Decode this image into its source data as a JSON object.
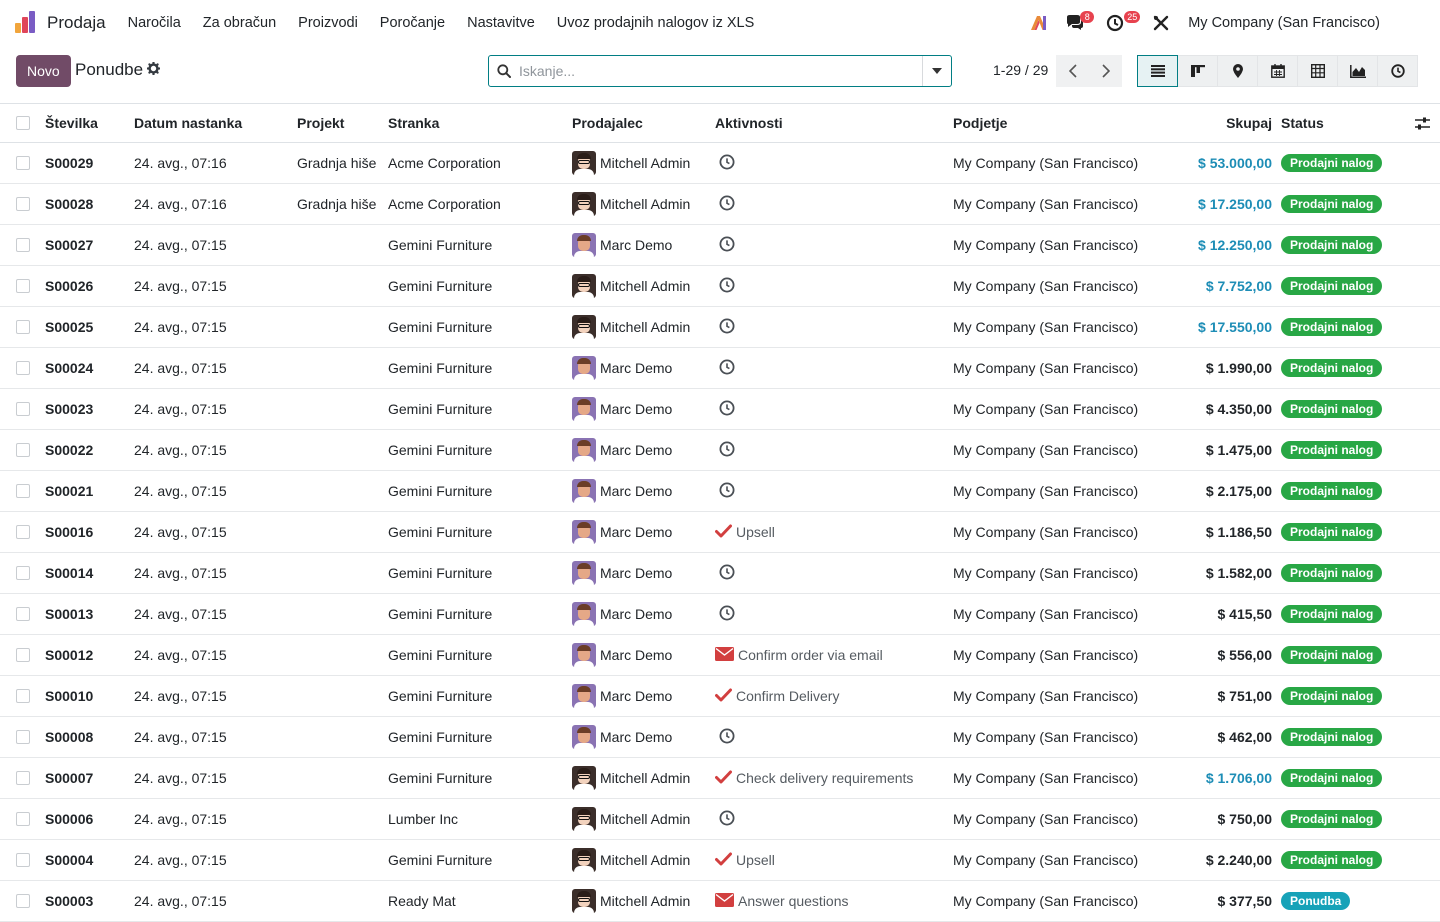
{
  "navbar": {
    "app_name": "Prodaja",
    "menu": [
      "Naročila",
      "Za obračun",
      "Proizvodi",
      "Poročanje",
      "Nastavitve",
      "Uvoz prodajnih nalogov iz XLS"
    ],
    "messages_count": "8",
    "activities_count": "25",
    "company": "My Company (San Francisco)"
  },
  "control": {
    "new_label": "Novo",
    "title": "Ponudbe",
    "search_placeholder": "Iskanje...",
    "pager": "1-29 / 29"
  },
  "colors": {
    "brand": "#714b67",
    "accent": "#017e84",
    "status_green": "#28a745",
    "status_blue": "#17a2b8",
    "amount_teal": "#1d8db6"
  },
  "columns": {
    "number": "Številka",
    "date": "Datum nastanka",
    "project": "Projekt",
    "customer": "Stranka",
    "salesperson": "Prodajalec",
    "activities": "Aktivnosti",
    "company": "Podjetje",
    "total": "Skupaj",
    "status": "Status"
  },
  "rows": [
    {
      "number": "S00029",
      "date": "24. avg., 07:16",
      "project": "Gradnja hiše",
      "customer": "Acme Corporation",
      "salesperson": "Mitchell Admin",
      "avatar": "mitchell",
      "activity_icon": "clock-icon",
      "activity": "",
      "company": "My Company (San Francisco)",
      "total": "$ 53.000,00",
      "total_teal": true,
      "status": "Prodajni nalog",
      "status_color": "green"
    },
    {
      "number": "S00028",
      "date": "24. avg., 07:16",
      "project": "Gradnja hiše",
      "customer": "Acme Corporation",
      "salesperson": "Mitchell Admin",
      "avatar": "mitchell",
      "activity_icon": "clock-icon",
      "activity": "",
      "company": "My Company (San Francisco)",
      "total": "$ 17.250,00",
      "total_teal": true,
      "status": "Prodajni nalog",
      "status_color": "green"
    },
    {
      "number": "S00027",
      "date": "24. avg., 07:15",
      "project": "",
      "customer": "Gemini Furniture",
      "salesperson": "Marc Demo",
      "avatar": "marc",
      "activity_icon": "clock-icon",
      "activity": "",
      "company": "My Company (San Francisco)",
      "total": "$ 12.250,00",
      "total_teal": true,
      "status": "Prodajni nalog",
      "status_color": "green"
    },
    {
      "number": "S00026",
      "date": "24. avg., 07:15",
      "project": "",
      "customer": "Gemini Furniture",
      "salesperson": "Mitchell Admin",
      "avatar": "mitchell",
      "activity_icon": "clock-icon",
      "activity": "",
      "company": "My Company (San Francisco)",
      "total": "$ 7.752,00",
      "total_teal": true,
      "status": "Prodajni nalog",
      "status_color": "green"
    },
    {
      "number": "S00025",
      "date": "24. avg., 07:15",
      "project": "",
      "customer": "Gemini Furniture",
      "salesperson": "Mitchell Admin",
      "avatar": "mitchell",
      "activity_icon": "clock-icon",
      "activity": "",
      "company": "My Company (San Francisco)",
      "total": "$ 17.550,00",
      "total_teal": true,
      "status": "Prodajni nalog",
      "status_color": "green"
    },
    {
      "number": "S00024",
      "date": "24. avg., 07:15",
      "project": "",
      "customer": "Gemini Furniture",
      "salesperson": "Marc Demo",
      "avatar": "marc",
      "activity_icon": "clock-icon",
      "activity": "",
      "company": "My Company (San Francisco)",
      "total": "$ 1.990,00",
      "total_teal": false,
      "status": "Prodajni nalog",
      "status_color": "green"
    },
    {
      "number": "S00023",
      "date": "24. avg., 07:15",
      "project": "",
      "customer": "Gemini Furniture",
      "salesperson": "Marc Demo",
      "avatar": "marc",
      "activity_icon": "clock-icon",
      "activity": "",
      "company": "My Company (San Francisco)",
      "total": "$ 4.350,00",
      "total_teal": false,
      "status": "Prodajni nalog",
      "status_color": "green"
    },
    {
      "number": "S00022",
      "date": "24. avg., 07:15",
      "project": "",
      "customer": "Gemini Furniture",
      "salesperson": "Marc Demo",
      "avatar": "marc",
      "activity_icon": "clock-icon",
      "activity": "",
      "company": "My Company (San Francisco)",
      "total": "$ 1.475,00",
      "total_teal": false,
      "status": "Prodajni nalog",
      "status_color": "green"
    },
    {
      "number": "S00021",
      "date": "24. avg., 07:15",
      "project": "",
      "customer": "Gemini Furniture",
      "salesperson": "Marc Demo",
      "avatar": "marc",
      "activity_icon": "clock-icon",
      "activity": "",
      "company": "My Company (San Francisco)",
      "total": "$ 2.175,00",
      "total_teal": false,
      "status": "Prodajni nalog",
      "status_color": "green"
    },
    {
      "number": "S00016",
      "date": "24. avg., 07:15",
      "project": "",
      "customer": "Gemini Furniture",
      "salesperson": "Marc Demo",
      "avatar": "marc",
      "activity_icon": "check-icon",
      "activity": "Upsell",
      "company": "My Company (San Francisco)",
      "total": "$ 1.186,50",
      "total_teal": false,
      "status": "Prodajni nalog",
      "status_color": "green"
    },
    {
      "number": "S00014",
      "date": "24. avg., 07:15",
      "project": "",
      "customer": "Gemini Furniture",
      "salesperson": "Marc Demo",
      "avatar": "marc",
      "activity_icon": "clock-icon",
      "activity": "",
      "company": "My Company (San Francisco)",
      "total": "$ 1.582,00",
      "total_teal": false,
      "status": "Prodajni nalog",
      "status_color": "green"
    },
    {
      "number": "S00013",
      "date": "24. avg., 07:15",
      "project": "",
      "customer": "Gemini Furniture",
      "salesperson": "Marc Demo",
      "avatar": "marc",
      "activity_icon": "clock-icon",
      "activity": "",
      "company": "My Company (San Francisco)",
      "total": "$ 415,50",
      "total_teal": false,
      "status": "Prodajni nalog",
      "status_color": "green"
    },
    {
      "number": "S00012",
      "date": "24. avg., 07:15",
      "project": "",
      "customer": "Gemini Furniture",
      "salesperson": "Marc Demo",
      "avatar": "marc",
      "activity_icon": "envelope-icon",
      "activity": "Confirm order via email",
      "company": "My Company (San Francisco)",
      "total": "$ 556,00",
      "total_teal": false,
      "status": "Prodajni nalog",
      "status_color": "green"
    },
    {
      "number": "S00010",
      "date": "24. avg., 07:15",
      "project": "",
      "customer": "Gemini Furniture",
      "salesperson": "Marc Demo",
      "avatar": "marc",
      "activity_icon": "check-icon",
      "activity": "Confirm Delivery",
      "company": "My Company (San Francisco)",
      "total": "$ 751,00",
      "total_teal": false,
      "status": "Prodajni nalog",
      "status_color": "green"
    },
    {
      "number": "S00008",
      "date": "24. avg., 07:15",
      "project": "",
      "customer": "Gemini Furniture",
      "salesperson": "Marc Demo",
      "avatar": "marc",
      "activity_icon": "clock-icon",
      "activity": "",
      "company": "My Company (San Francisco)",
      "total": "$ 462,00",
      "total_teal": false,
      "status": "Prodajni nalog",
      "status_color": "green"
    },
    {
      "number": "S00007",
      "date": "24. avg., 07:15",
      "project": "",
      "customer": "Gemini Furniture",
      "salesperson": "Mitchell Admin",
      "avatar": "mitchell",
      "activity_icon": "check-icon",
      "activity": "Check delivery requirements",
      "company": "My Company (San Francisco)",
      "total": "$ 1.706,00",
      "total_teal": true,
      "status": "Prodajni nalog",
      "status_color": "green"
    },
    {
      "number": "S00006",
      "date": "24. avg., 07:15",
      "project": "",
      "customer": "Lumber Inc",
      "salesperson": "Mitchell Admin",
      "avatar": "mitchell",
      "activity_icon": "clock-icon",
      "activity": "",
      "company": "My Company (San Francisco)",
      "total": "$ 750,00",
      "total_teal": false,
      "status": "Prodajni nalog",
      "status_color": "green"
    },
    {
      "number": "S00004",
      "date": "24. avg., 07:15",
      "project": "",
      "customer": "Gemini Furniture",
      "salesperson": "Mitchell Admin",
      "avatar": "mitchell",
      "activity_icon": "check-icon",
      "activity": "Upsell",
      "company": "My Company (San Francisco)",
      "total": "$ 2.240,00",
      "total_teal": false,
      "status": "Prodajni nalog",
      "status_color": "green"
    },
    {
      "number": "S00003",
      "date": "24. avg., 07:15",
      "project": "",
      "customer": "Ready Mat",
      "salesperson": "Mitchell Admin",
      "avatar": "mitchell",
      "activity_icon": "envelope-icon",
      "activity": "Answer questions",
      "company": "My Company (San Francisco)",
      "total": "$ 377,50",
      "total_teal": false,
      "status": "Ponudba",
      "status_color": "blue"
    }
  ]
}
